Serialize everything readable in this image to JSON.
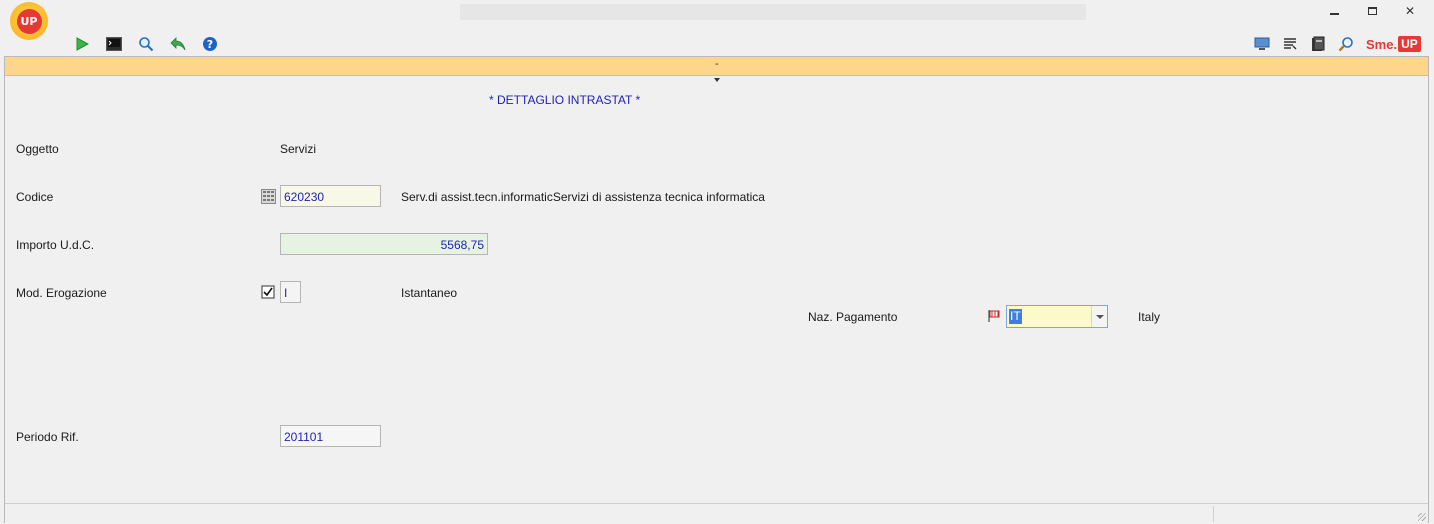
{
  "window": {
    "controls": {
      "minimize_icon": "minimize-icon",
      "restore_icon": "restore-icon",
      "close_icon": "close-icon",
      "close_glyph": "✕"
    }
  },
  "brand": {
    "logo_text": "UP",
    "smeup_text": "Sme.",
    "smeup_box": "UP"
  },
  "toolbar": {
    "left": [
      "play-icon",
      "terminal-icon",
      "search-icon",
      "undo-icon",
      "help-icon"
    ],
    "right": [
      "monitor-icon",
      "list-icon",
      "book-icon",
      "zoom-icon"
    ]
  },
  "header": {
    "separator_text": "-",
    "title": "* DETTAGLIO INTRASTAT *"
  },
  "form": {
    "oggetto": {
      "label": "Oggetto",
      "value": "Servizi"
    },
    "codice": {
      "label": "Codice",
      "value": "620230",
      "description": "Serv.di assist.tecn.informaticServizi di assistenza tecnica informatica"
    },
    "importo": {
      "label": "Importo U.d.C.",
      "value": "5568,75"
    },
    "erogazione": {
      "label": "Mod. Erogazione",
      "value": "I",
      "description": "Istantaneo"
    },
    "pagamento": {
      "label": "Naz. Pagamento",
      "value": "IT",
      "description": "Italy"
    },
    "periodo": {
      "label": "Periodo Rif.",
      "value": "201101"
    }
  },
  "colors": {
    "accent_bar": "#fdd58b",
    "value_text": "#1f1fb8",
    "brand_red": "#e53935"
  }
}
